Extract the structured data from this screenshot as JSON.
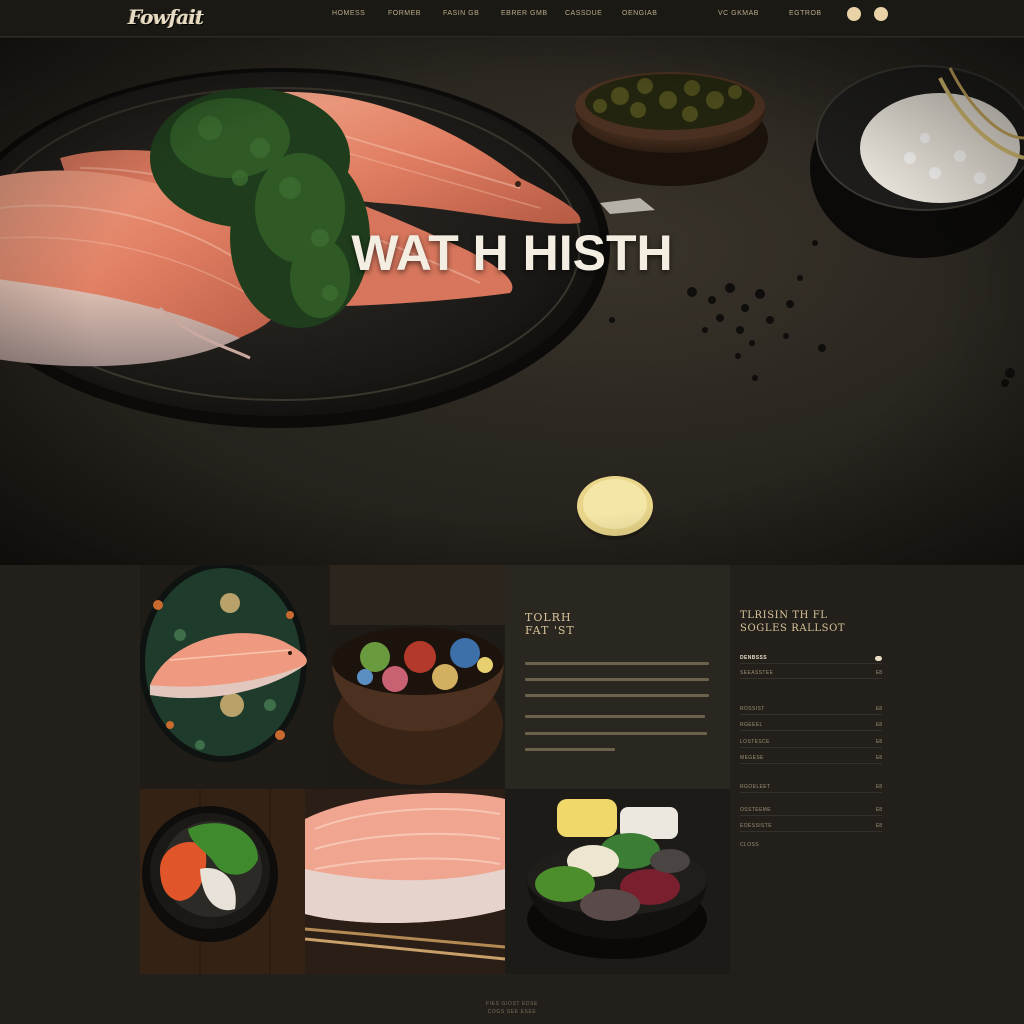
{
  "brand": {
    "logo_text": "Fowfait"
  },
  "nav": {
    "items": [
      "HOMESS",
      "FORMEB",
      "FASIN GB",
      "EBRER GMB",
      "CASSDUE",
      "OENGIAB",
      "VC GKMAB",
      "EGTROB"
    ],
    "action_dots": [
      "account",
      "cart"
    ]
  },
  "hero": {
    "title": "WAT H  HISTH"
  },
  "story": {
    "heading_line1": "TOLRH",
    "heading_line2": "FAT 'ST"
  },
  "menu": {
    "heading_line1": "TLRISIN TH FL",
    "heading_line2": "SOGLES RALLSOT",
    "items": [
      {
        "label": "DENBSSS",
        "value": ""
      },
      {
        "label": "SEEASSTEE",
        "value": "E8"
      },
      {
        "label": "ROSSIST",
        "value": "E8"
      },
      {
        "label": "RGEEEL",
        "value": "E8"
      },
      {
        "label": "LOSTESCE",
        "value": "E8"
      },
      {
        "label": "MEGESE",
        "value": "E8"
      },
      {
        "label": "RGOELEET",
        "value": "E8"
      },
      {
        "label": "OSSTEEME",
        "value": "E8"
      },
      {
        "label": "EOESSISTE",
        "value": "E8"
      },
      {
        "label": "CLOSS",
        "value": ""
      }
    ]
  },
  "footer": {
    "line1": "FIES GIOST EDSE",
    "line2": "COGS SEE ESEE"
  },
  "colors": {
    "background": "#23201b",
    "accent": "#e9d2a8",
    "text": "#d9c9a8"
  }
}
